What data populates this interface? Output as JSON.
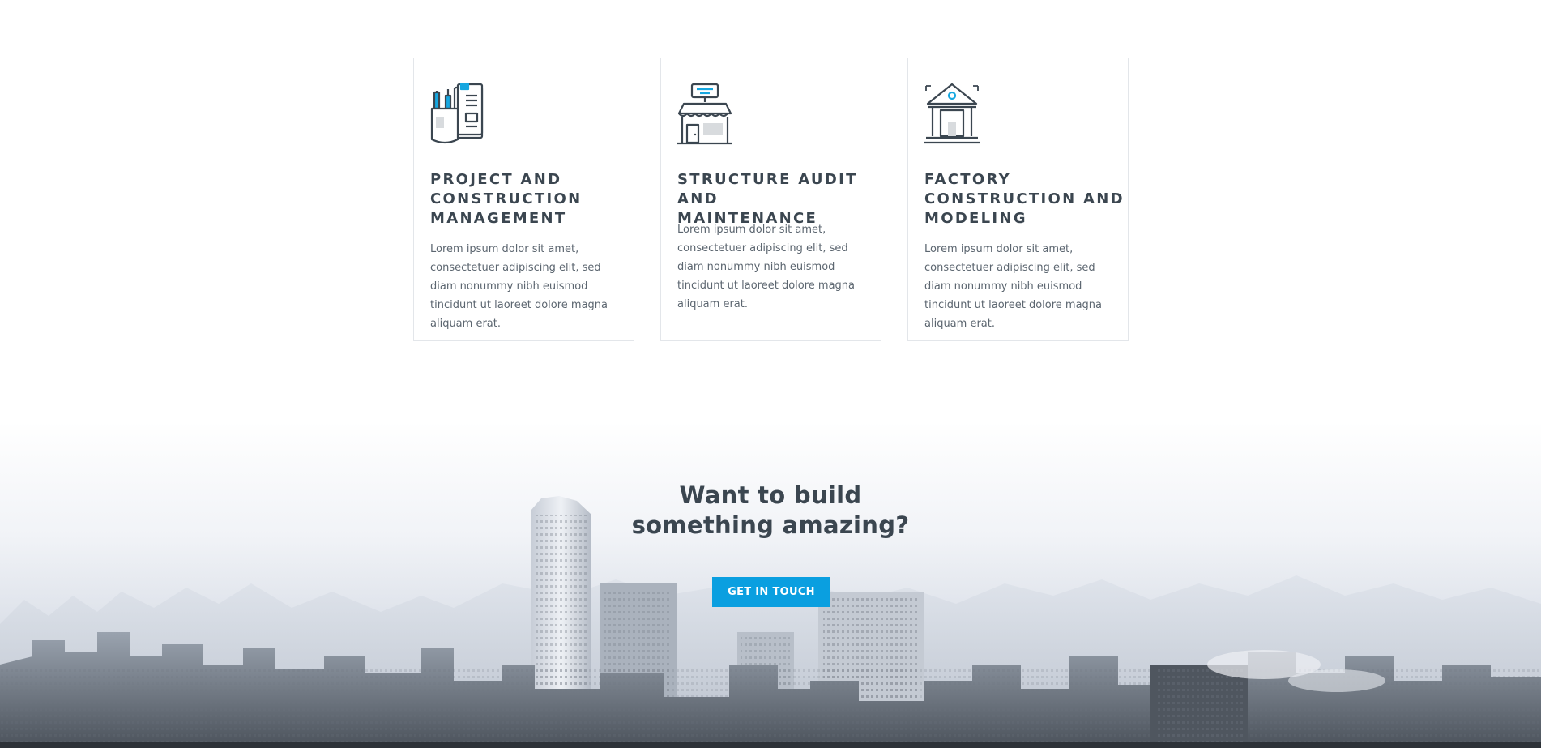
{
  "services": [
    {
      "icon": "document-holder-icon",
      "title_line1": "PROJECT AND",
      "title_line2": "CONSTRUCTION",
      "title_line3": "MANAGEMENT",
      "text": "Lorem ipsum dolor sit amet, consectetuer adipiscing elit, sed diam nonummy nibh euismod tincidunt ut laoreet dolore magna aliquam erat."
    },
    {
      "icon": "storefront-icon",
      "title_line1": "STRUCTURE AUDIT AND",
      "title_line2": "MAINTENANCE",
      "text": "Lorem ipsum dolor sit amet, consectetuer adipiscing elit, sed diam nonummy nibh euismod tincidunt ut laoreet dolore magna aliquam erat."
    },
    {
      "icon": "institution-building-icon",
      "title_line1": "FACTORY",
      "title_line2": "CONSTRUCTION AND",
      "title_line3": "MODELING",
      "text": "Lorem ipsum dolor sit amet, consectetuer adipiscing elit, sed diam nonummy nibh euismod tincidunt ut laoreet dolore magna aliquam erat."
    }
  ],
  "cta": {
    "heading_line1": "Want to build",
    "heading_line2": "something amazing?",
    "button_label": "GET IN TOUCH",
    "background": "city-skyline-image"
  },
  "colors": {
    "accent": "#0a9fe0",
    "heading": "#3b4650",
    "body_text": "#5c6670",
    "card_border": "#e3e6ea"
  }
}
